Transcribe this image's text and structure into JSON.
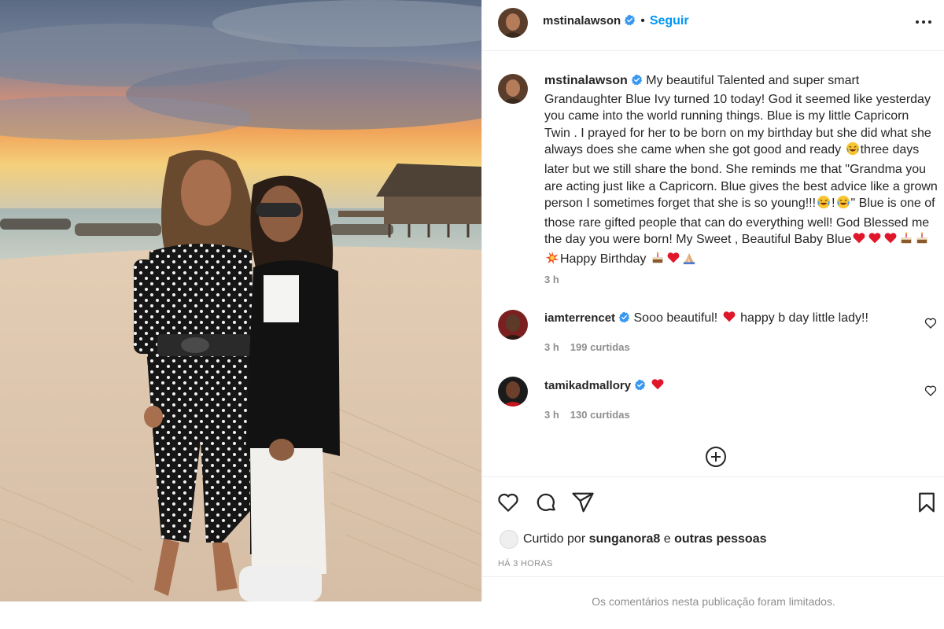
{
  "post": {
    "author": "mstinalawson",
    "separator": "•",
    "follow_label": "Seguir",
    "caption_text_1": "My beautiful Talented and super smart Grandaughter Blue Ivy turned 10 today! God it seemed like yesterday you came into the world running things. Blue is my little Capricorn Twin . I prayed for her to be born on my birthday but she did what she always does she came when she got good and ready",
    "caption_text_2": "three days later but we still share the bond. She reminds me that \"Grandma you are acting just like a Capricorn. Blue gives the best advice like a grown person I sometimes forget that she is so young!!!",
    "caption_text_3": "!",
    "caption_text_4": "\" Blue is one of those rare gifted people that can do everything well! God Blessed me the day you were born! My Sweet , Beautiful Baby Blue",
    "caption_text_5": "Happy Birthday",
    "caption_time": "3 h"
  },
  "comments": [
    {
      "user": "iamterrencet",
      "text_1": "Sooo beautiful!",
      "text_2": "happy b day little lady!!",
      "time": "3 h",
      "likes": "199 curtidas"
    },
    {
      "user": "tamikadmallory",
      "time": "3 h",
      "likes": "130 curtidas"
    }
  ],
  "liked_by": {
    "prefix": "Curtido por",
    "user": "sunganora8",
    "conj": "e",
    "others": "outras pessoas"
  },
  "timestamp": "HÁ 3 HORAS",
  "limited_notice": "Os comentários nesta publicação foram limitados.",
  "colors": {
    "accent": "#0095f6",
    "verified": "#3897f0",
    "heart": "#ed4956"
  },
  "icons": [
    "verified-badge-icon",
    "more-options-icon",
    "heart-icon",
    "comment-icon",
    "share-icon",
    "bookmark-icon",
    "add-comment-icon"
  ]
}
